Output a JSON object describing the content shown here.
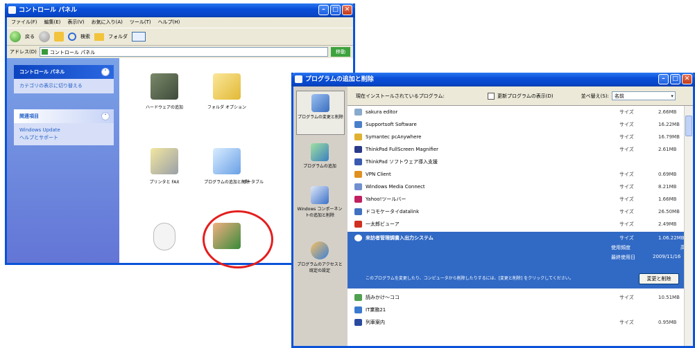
{
  "control_panel": {
    "title": "コントロール パネル",
    "menu": [
      "ファイル(F)",
      "編集(E)",
      "表示(V)",
      "お気に入り(A)",
      "ツール(T)",
      "ヘルプ(H)"
    ],
    "toolbar": {
      "back": "戻る",
      "search": "検索",
      "folders": "フォルダ"
    },
    "address_label": "アドレス(D)",
    "address_value": "コントロール パネル",
    "go_label": "移動",
    "side_panel_title": "コントロール パネル",
    "side_panel_link": "カテゴリの表示に切り替える",
    "related_title": "関連項目",
    "related_links": [
      "Windows Update",
      "ヘルプとサポート"
    ],
    "icons": [
      {
        "label": "ハードウェアの追加",
        "icon": "hardware-icon"
      },
      {
        "label": "フォルダ オプション",
        "icon": "folder-options-icon"
      },
      {
        "label": "プリンタと FAX",
        "icon": "printer-icon"
      },
      {
        "label": "プログラムの追加と削除",
        "icon": "add-remove-programs-icon"
      },
      {
        "label": "ポータブル",
        "icon": "portable-icon"
      },
      {
        "label": "",
        "icon": "mouse-icon"
      },
      {
        "label": "",
        "icon": "users-icon"
      }
    ]
  },
  "add_remove": {
    "title": "プログラムの追加と削除",
    "sidebar": [
      "プログラムの変更と削除",
      "プログラムの追加",
      "Windows コンポーネントの追加と削除",
      "プログラムのアクセスと既定の設定"
    ],
    "installed_label": "現在インストールされているプログラム:",
    "show_updates_label": "更新プログラムの表示(D)",
    "sort_label": "並べ替え(S):",
    "sort_value": "名前",
    "programs": [
      {
        "name": "sakura editor",
        "size_label": "サイズ",
        "size": "2.66MB"
      },
      {
        "name": "Supportsoft Software",
        "size_label": "サイズ",
        "size": "16.22MB"
      },
      {
        "name": "Symantec pcAnywhere",
        "size_label": "サイズ",
        "size": "16.79MB"
      },
      {
        "name": "ThinkPad FullScreen Magnifier",
        "size_label": "サイズ",
        "size": "2.61MB"
      },
      {
        "name": "ThinkPad ソフトウェア導入支援",
        "size_label": "",
        "size": ""
      },
      {
        "name": "VPN Client",
        "size_label": "サイズ",
        "size": "0.69MB"
      },
      {
        "name": "Windows Media Connect",
        "size_label": "サイズ",
        "size": "8.21MB"
      },
      {
        "name": "Yahoo!ツールバー",
        "size_label": "サイズ",
        "size": "1.66MB"
      },
      {
        "name": "ドコモケータイdatalink",
        "size_label": "サイズ",
        "size": "26.50MB"
      },
      {
        "name": "一太郎ビューア",
        "size_label": "サイズ",
        "size": "2.49MB"
      }
    ],
    "selected": {
      "name": "来訪者管理調書入出力システム",
      "size_label": "サイズ",
      "size": "1.06.22MB",
      "usage_label": "使用頻度",
      "usage_value": "高",
      "last_used_label": "最終使用日",
      "last_used_value": "2009/11/16",
      "hint": "このプログラムを変更したり、コンピュータから削除したりするには、[変更と削除] をクリックしてください。",
      "button": "変更と削除"
    },
    "programs_after": [
      {
        "name": "読みかけ〜ココ",
        "size_label": "サイズ",
        "size": "10.51MB"
      },
      {
        "name": "IT業務21",
        "size_label": "",
        "size": ""
      },
      {
        "name": "列車案内",
        "size_label": "サイズ",
        "size": "0.95MB"
      }
    ]
  }
}
